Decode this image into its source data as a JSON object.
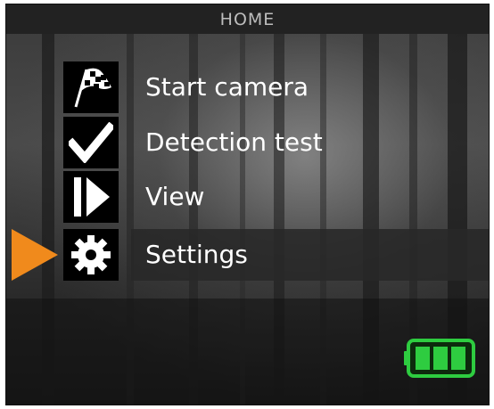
{
  "header": {
    "title": "HOME"
  },
  "menu": {
    "items": [
      {
        "label": "Start camera",
        "icon": "checkered-flag-icon"
      },
      {
        "label": "Detection test",
        "icon": "checkmark-icon"
      },
      {
        "label": "View",
        "icon": "play-icon"
      },
      {
        "label": "Settings",
        "icon": "gear-icon"
      }
    ],
    "selected_index": 3
  },
  "status": {
    "battery_level": "3/3 bars"
  },
  "colors": {
    "selector": "#f08a1c",
    "battery": "#2ecc40",
    "text": "#ffffff",
    "header_bg": "#222222"
  }
}
